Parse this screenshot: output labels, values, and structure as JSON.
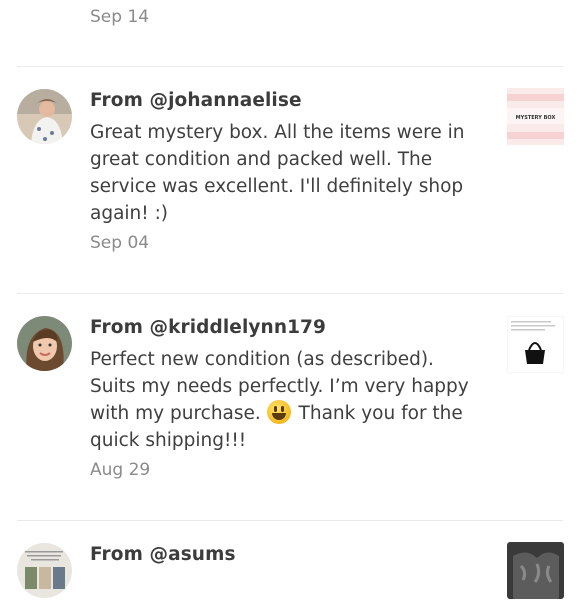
{
  "reviews": [
    {
      "date": "Sep 14"
    },
    {
      "from": "From @johannaelise",
      "text": "Great mystery box. All the items were in great condition and packed well. The service was excellent. I'll definitely shop again! :)",
      "date": "Sep 04",
      "thumb_label": "MYSTERY BOX"
    },
    {
      "from": "From @kriddlelynn179",
      "text_before": "Perfect new condition (as described). Suits my needs perfectly. I’m very happy with my purchase. ",
      "text_after": " Thank you for the quick shipping!!!",
      "date": "Aug 29"
    },
    {
      "from": "From @asums"
    }
  ]
}
